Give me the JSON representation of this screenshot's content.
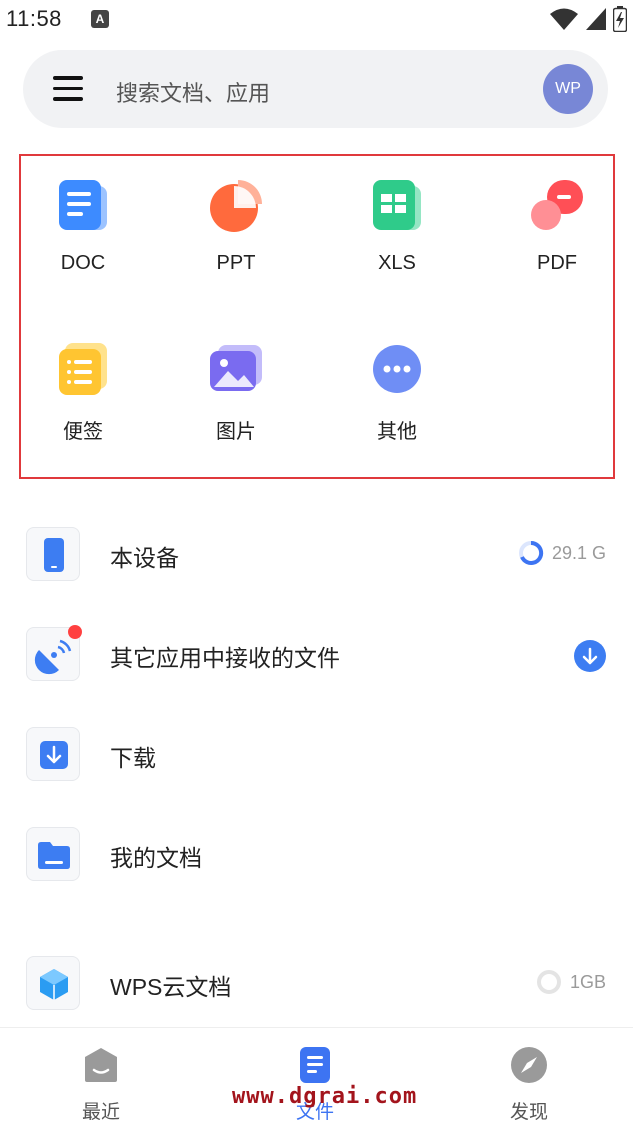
{
  "status_bar": {
    "time": "11:58",
    "notice": "A"
  },
  "search": {
    "placeholder": "搜索文档、应用",
    "avatar": "WP"
  },
  "categories": [
    {
      "label": "DOC",
      "icon": "doc-icon",
      "color": "#3d8bff"
    },
    {
      "label": "PPT",
      "icon": "ppt-icon",
      "color": "#ff6a3d"
    },
    {
      "label": "XLS",
      "icon": "xls-icon",
      "color": "#2fcb8a"
    },
    {
      "label": "PDF",
      "icon": "pdf-icon",
      "color": "#ff4f56"
    },
    {
      "label": "便签",
      "icon": "note-icon",
      "color": "#ffc531"
    },
    {
      "label": "图片",
      "icon": "image-icon",
      "color": "#7a6bf0"
    },
    {
      "label": "其他",
      "icon": "more-icon",
      "color": "#6f8ef5"
    }
  ],
  "locations": [
    {
      "label": "本设备",
      "icon": "phone-icon",
      "right_text": "29.1 G"
    },
    {
      "label": "其它应用中接收的文件",
      "icon": "satellite-icon",
      "right_text": ""
    },
    {
      "label": "下载",
      "icon": "download-icon",
      "right_text": ""
    },
    {
      "label": "我的文档",
      "icon": "folder-icon",
      "right_text": ""
    },
    {
      "label": "WPS云文档",
      "icon": "cloud-cube-icon",
      "right_text": "1GB"
    }
  ],
  "nav": [
    {
      "label": "最近",
      "active": false
    },
    {
      "label": "文件",
      "active": true
    },
    {
      "label": "发现",
      "active": false
    }
  ],
  "watermark": "www.dgrai.com",
  "colors": {
    "accent": "#3d74f2",
    "highlight_border": "#e0393c",
    "badge": "#ff4040"
  }
}
